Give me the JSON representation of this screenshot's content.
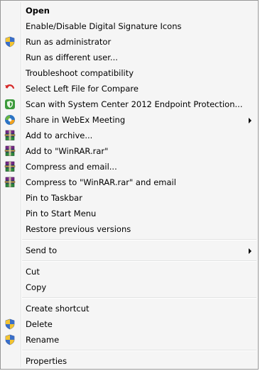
{
  "menu": {
    "items": [
      {
        "label": "Open",
        "bold": true,
        "icon": ""
      },
      {
        "label": "Enable/Disable Digital Signature Icons",
        "icon": ""
      },
      {
        "label": "Run as administrator",
        "icon": "uac-shield-icon"
      },
      {
        "label": "Run as different user...",
        "icon": ""
      },
      {
        "label": "Troubleshoot compatibility",
        "icon": ""
      },
      {
        "label": "Select Left File for Compare",
        "icon": "compare-arrow-icon"
      },
      {
        "label": "Scan with System Center 2012 Endpoint Protection...",
        "icon": "endpoint-protection-icon"
      },
      {
        "label": "Share in WebEx Meeting",
        "icon": "webex-icon",
        "submenu": true
      },
      {
        "label": "Add to archive...",
        "icon": "winrar-icon"
      },
      {
        "label": "Add to \"WinRAR.rar\"",
        "icon": "winrar-icon"
      },
      {
        "label": "Compress and email...",
        "icon": "winrar-icon"
      },
      {
        "label": "Compress to \"WinRAR.rar\" and email",
        "icon": "winrar-icon"
      },
      {
        "label": "Pin to Taskbar",
        "icon": ""
      },
      {
        "label": "Pin to Start Menu",
        "icon": ""
      },
      {
        "label": "Restore previous versions",
        "icon": ""
      },
      {
        "separator": true
      },
      {
        "label": "Send to",
        "icon": "",
        "submenu": true
      },
      {
        "separator": true
      },
      {
        "label": "Cut",
        "icon": ""
      },
      {
        "label": "Copy",
        "icon": ""
      },
      {
        "separator": true
      },
      {
        "label": "Create shortcut",
        "icon": ""
      },
      {
        "label": "Delete",
        "icon": "uac-shield-icon"
      },
      {
        "label": "Rename",
        "icon": "uac-shield-icon"
      },
      {
        "separator": true
      },
      {
        "label": "Properties",
        "icon": ""
      }
    ]
  }
}
